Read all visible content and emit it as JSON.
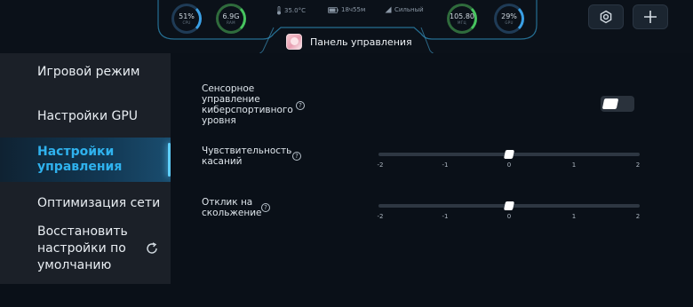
{
  "topbar": {
    "gauges": [
      {
        "value": "51%",
        "unit": "CPU"
      },
      {
        "value": "6.9G",
        "unit": "RAM"
      },
      {
        "value": "105.80",
        "unit": "МГЦ"
      },
      {
        "value": "29%",
        "unit": "GPU"
      }
    ],
    "battery_temp": "35.0°C",
    "time": "18ч55м",
    "signal": "Сильный"
  },
  "tab": {
    "label": "Панель управления"
  },
  "sidebar": {
    "items": [
      {
        "label": "Игровой режим"
      },
      {
        "label": "Настройки GPU"
      },
      {
        "label": "Настройки управления"
      },
      {
        "label": "Оптимизация сети"
      },
      {
        "label": "Восстановить настройки по умолчанию"
      }
    ],
    "active_index": 2
  },
  "settings": {
    "esports_touch": {
      "label": "Сенсорное управление киберспортивного уровня",
      "enabled": true
    },
    "touch_sensitivity": {
      "label": "Чувствительность касаний",
      "value": 0,
      "ticks": [
        "-2",
        "-1",
        "0",
        "1",
        "2"
      ]
    },
    "slide_response": {
      "label": "Отклик на скольжение",
      "value": 0,
      "ticks": [
        "-2",
        "-1",
        "0",
        "1",
        "2"
      ]
    }
  },
  "icons": {
    "settings": "gear-icon",
    "add": "plus-icon",
    "help": "question-circle-icon",
    "reset": "refresh-icon"
  },
  "colors": {
    "accent": "#2fb2ee",
    "background": "#0a1018",
    "sidebar": "#1b2028",
    "gauge_green": "#47c45f",
    "gauge_blue": "#3aa0e6"
  }
}
